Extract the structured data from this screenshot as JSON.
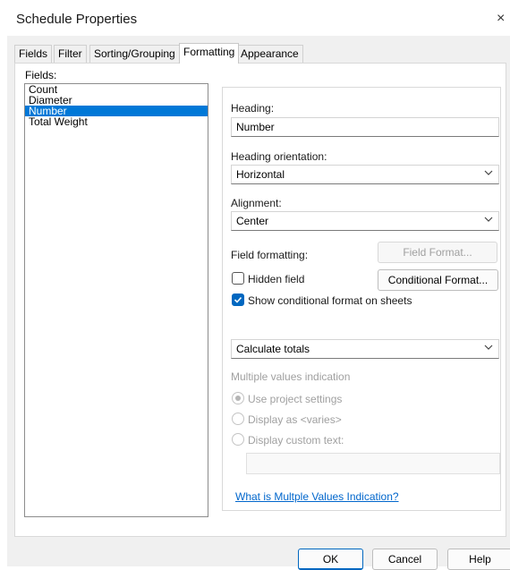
{
  "window": {
    "title": "Schedule Properties",
    "close_symbol": "×"
  },
  "tabs": [
    "Fields",
    "Filter",
    "Sorting/Grouping",
    "Formatting",
    "Appearance"
  ],
  "active_tab": "Formatting",
  "fields": {
    "label": "Fields:",
    "items": [
      "Count",
      "Diameter",
      "Number",
      "Total Weight"
    ],
    "selected": "Number"
  },
  "formatting": {
    "heading_label": "Heading:",
    "heading_value": "Number",
    "orientation_label": "Heading orientation:",
    "orientation_value": "Horizontal",
    "alignment_label": "Alignment:",
    "alignment_value": "Center",
    "field_formatting_label": "Field formatting:",
    "field_format_button": "Field Format...",
    "hidden_field_label": "Hidden field",
    "hidden_field_checked": false,
    "conditional_format_button": "Conditional  Format...",
    "show_conditional_label": "Show conditional format on sheets",
    "show_conditional_checked": true,
    "totals_value": "Calculate totals",
    "multiple_values_label": "Multiple values indication",
    "radio_options": [
      "Use project settings",
      "Display as <varies>",
      "Display custom text:"
    ],
    "radio_selected": "Use project settings",
    "custom_text_value": "",
    "help_link": "What is Multple Values Indication?"
  },
  "footer": {
    "ok": "OK",
    "cancel": "Cancel",
    "help": "Help"
  },
  "colors": {
    "selection": "#0078d7",
    "accent": "#0067c0",
    "link": "#0066cc",
    "dialog_bg": "#f0f0f0"
  }
}
